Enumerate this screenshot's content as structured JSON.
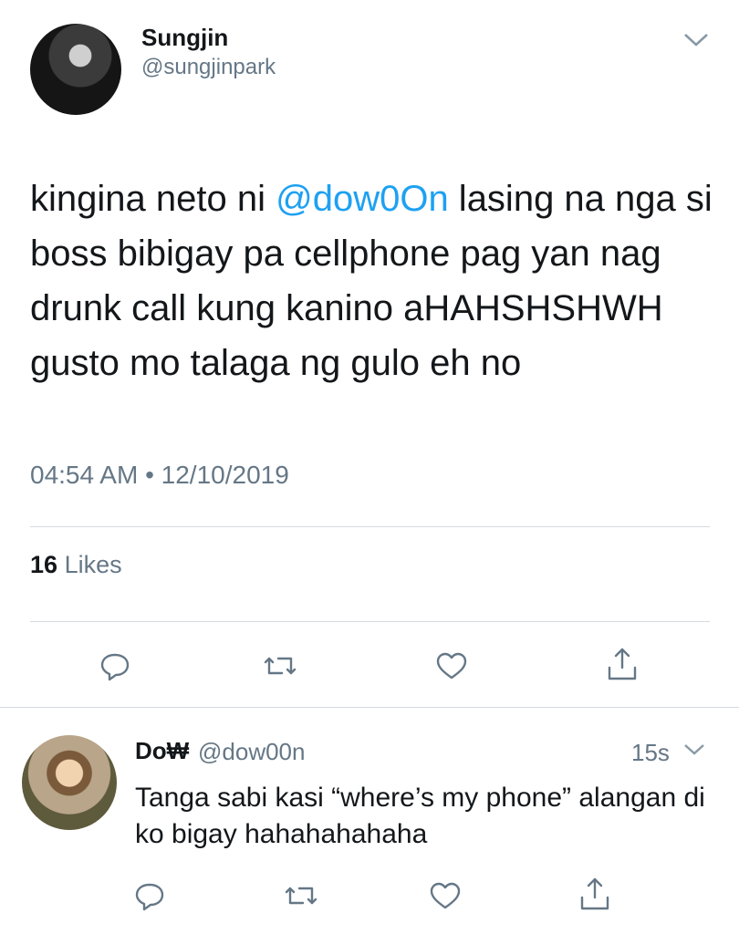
{
  "tweet": {
    "display_name": "Sungjin",
    "handle": "@sungjinpark",
    "text_before": "kingina neto ni ",
    "mention": "@dow0On",
    "text_after": " lasing na nga si boss bibigay pa cellphone pag yan nag drunk call kung kanino aHAHSHSHWH gusto mo talaga ng gulo eh no",
    "timestamp": "04:54 AM • 12/10/2019",
    "likes_count": "16",
    "likes_label": "Likes",
    "accent_color": "#1da1f2"
  },
  "reply": {
    "display_name": "Do₩",
    "handle": "@dow00n",
    "time": "15s",
    "text": "Tanga sabi kasi “where’s my phone” alangan di ko bigay hahahahahaha"
  },
  "icons": {
    "reply": "reply-icon",
    "retweet": "retweet-icon",
    "like": "heart-icon",
    "share": "share-icon",
    "more": "chevron-down-icon"
  }
}
